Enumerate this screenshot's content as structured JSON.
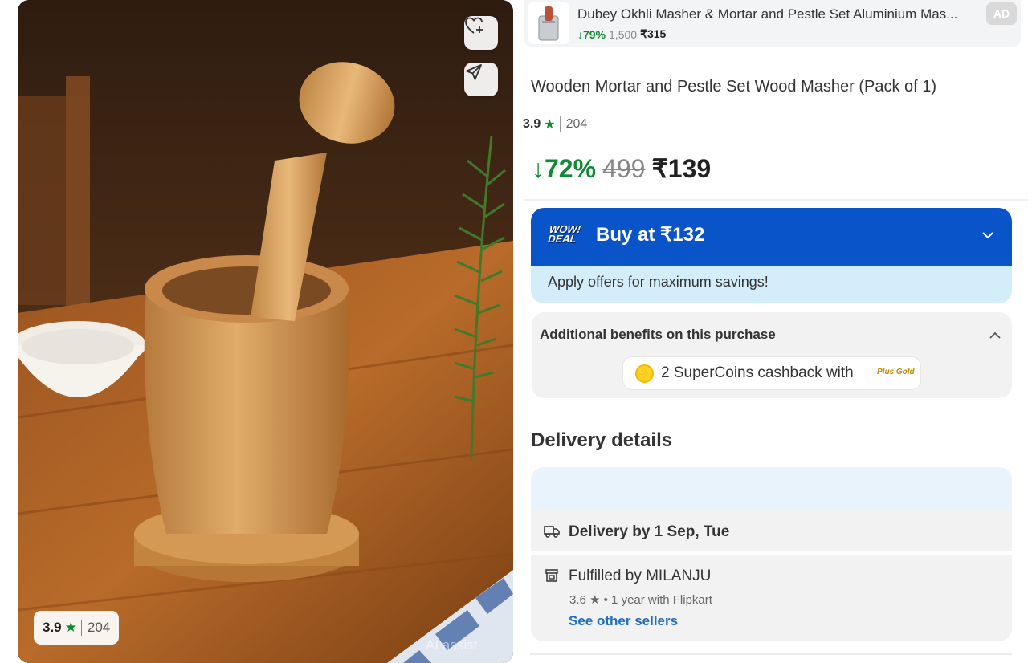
{
  "product_image": {
    "rating_value": "3.9",
    "rating_count": "204",
    "watermark": "AI assist",
    "wishlist_icon": "heart-plus-icon",
    "share_icon": "send-icon"
  },
  "ad": {
    "title": "Dubey Okhli Masher & Mortar and Pestle Set Aluminium Mas...",
    "discount": "↓79%",
    "mrp": "1,500",
    "price": "₹315",
    "badge": "AD"
  },
  "product": {
    "title": "Wooden Mortar and Pestle Set Wood Masher (Pack of 1)",
    "rating_value": "3.9",
    "rating_count": "204",
    "discount": "↓72%",
    "mrp": "499",
    "price": "₹139"
  },
  "deal": {
    "badge_line1": "WOW!",
    "badge_line2": "DEAL",
    "title": "Buy at ₹132",
    "subtitle": "Apply offers for maximum savings!"
  },
  "benefits": {
    "title": "Additional benefits on this purchase",
    "cashback": "2 SuperCoins cashback with",
    "plus_label": "Plus Gold"
  },
  "delivery": {
    "heading": "Delivery details",
    "date": "Delivery by 1 Sep, Tue",
    "fulfilled": "Fulfilled by MILANJU",
    "seller_meta": "3.6 ★ • 1 year with Flipkart",
    "other_sellers": "See other sellers"
  },
  "colors": {
    "green": "#108934",
    "blue": "#0a54c9",
    "link": "#1f6fbf"
  }
}
